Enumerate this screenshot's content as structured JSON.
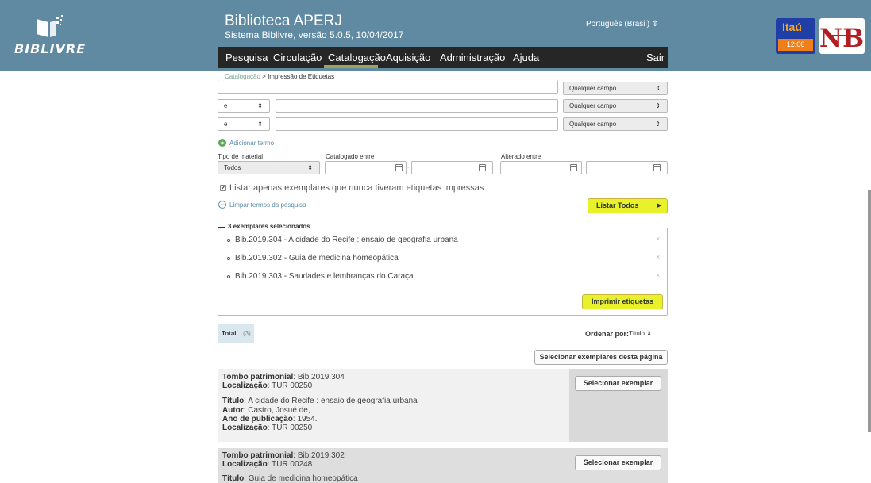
{
  "header": {
    "logo_text": "BIBLIVRE",
    "title": "Biblioteca APERJ",
    "subtitle": "Sistema Biblivre, versão 5.0.5, 10/04/2017",
    "language": "Português (Brasil)",
    "language_arrow": "⇕",
    "bank_name": "Itaú",
    "clock": "12:06",
    "seal_label": "NB"
  },
  "menu": {
    "items": [
      "Pesquisa",
      "Circulação",
      "Catalogação",
      "Aquisição",
      "Administração",
      "Ajuda"
    ],
    "active": "Catalogação",
    "logout": "Sair"
  },
  "breadcrumb": {
    "parent": "Catalogação",
    "separator": ">",
    "current": "Impressão de Etiquetas"
  },
  "search": {
    "field_option": "Qualquer campo",
    "operator": "e",
    "select_arrow": "⇕",
    "add_term": "Adicionar termo",
    "material_type_label": "Tipo de material",
    "material_type_value": "Todos",
    "catalogued_label": "Catalogado entre",
    "changed_label": "Alterado entre",
    "range_separator": "-",
    "checkbox_checked": true,
    "checkbox_mark": "✔",
    "checkbox_label": "Listar apenas exemplares que nunca tiveram etiquetas impressas",
    "clear_terms": "Limpar termos da pesquisa",
    "list_all": "Listar Todos",
    "list_all_arrow": "▶"
  },
  "selection": {
    "title": "3 exemplares selecionados",
    "items": [
      "Bib.2019.304 - A cidade do Recife : ensaio de geografia urbana",
      "Bib.2019.302 - Guia de medicina homeopática",
      "Bib.2019.303 - Saudades e lembranças do Caraça"
    ],
    "remove_symbol": "×",
    "print_button": "Imprimir etiquetas"
  },
  "results": {
    "total_label": "Total",
    "total_count": "(3)",
    "order_label": "Ordenar por:",
    "order_value": "Título",
    "order_arrow": "⇕",
    "select_page_button": "Selecionar exemplares desta página",
    "select_item_button": "Selecionar exemplar",
    "cards": [
      {
        "tombo_label": "Tombo patrimonial",
        "tombo": "Bib.2019.304",
        "location_label": "Localização",
        "location": "TUR 00250",
        "title_label": "Título",
        "title": "A cidade do Recife : ensaio de geografia urbana",
        "author_label": "Autor",
        "author": "Castro, Josué de,",
        "year_label": "Ano de publicação",
        "year": "1954.",
        "location2": "TUR 00250"
      },
      {
        "tombo_label": "Tombo patrimonial",
        "tombo": "Bib.2019.302",
        "location_label": "Localização",
        "location": "TUR 00248",
        "title_label": "Título",
        "title": "Guia de medicina homeopática"
      }
    ]
  },
  "colors": {
    "header_bg": "#5f8aa2",
    "menu_bg": "#262626",
    "menu_active": "#9fa25b",
    "accent_button": "#e8f22a",
    "bank_blue": "#1f3fa6",
    "bank_orange": "#f07f19",
    "seal_red": "#b21e23"
  },
  "icons": [
    "book-logo-icon",
    "calendar-icon",
    "add-icon",
    "clear-icon",
    "remove-icon",
    "arrow-right-icon",
    "seal-logo-icon"
  ]
}
